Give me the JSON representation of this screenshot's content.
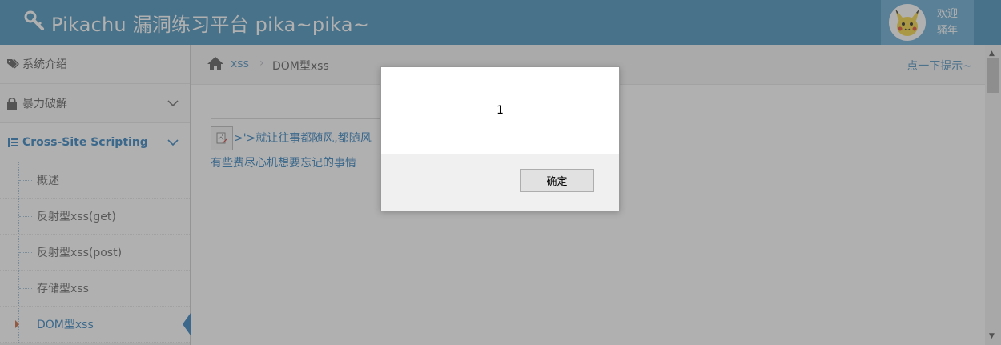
{
  "header": {
    "brand": "Pikachu 漏洞练习平台 pika~pika~",
    "welcome_line1": "欢迎",
    "welcome_line2": "骚年"
  },
  "sidebar": {
    "items": [
      {
        "label": "系统介绍",
        "icon": "tags-icon"
      },
      {
        "label": "暴力破解",
        "icon": "lock-icon"
      },
      {
        "label": "Cross-Site Scripting",
        "icon": "list-icon"
      }
    ],
    "subitems": [
      {
        "label": "概述"
      },
      {
        "label": "反射型xss(get)"
      },
      {
        "label": "反射型xss(post)"
      },
      {
        "label": "存储型xss"
      },
      {
        "label": "DOM型xss",
        "active": true
      }
    ]
  },
  "breadcrumb": {
    "link": "xss",
    "separator": "›",
    "current": "DOM型xss",
    "tip": "点一下提示~"
  },
  "main": {
    "input_value": "",
    "xss_link_text": ">'>就让往事都随风,都随风",
    "line2_text": "有些费尽心机想要忘记的事情"
  },
  "dialog": {
    "message": "1",
    "ok_label": "确定"
  },
  "colors": {
    "header_bg": "#438eb9",
    "accent": "#2b7dbc",
    "overlay": "rgba(80,80,80,0.45)"
  }
}
